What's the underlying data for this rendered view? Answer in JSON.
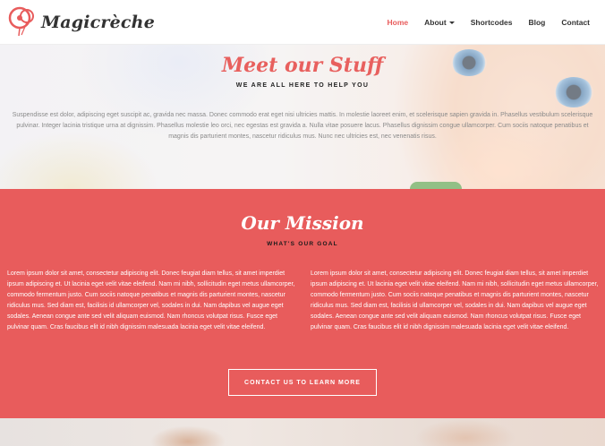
{
  "brand": {
    "name": "Magicrèche",
    "accent": "#e85c5c"
  },
  "nav": {
    "items": [
      {
        "label": "Home",
        "active": true
      },
      {
        "label": "About",
        "dropdown": true
      },
      {
        "label": "Shortcodes"
      },
      {
        "label": "Blog"
      },
      {
        "label": "Contact"
      }
    ]
  },
  "hero": {
    "title": "Meet our Stuff",
    "subtitle": "WE ARE ALL HERE TO HELP YOU",
    "text": "Suspendisse est dolor, adipiscing eget suscipit ac, gravida nec massa. Donec commodo erat eget nisi ultricies mattis. In molestie laoreet enim, et scelerisque sapien gravida in. Phasellus vestibulum scelerisque pulvinar. Integer lacinia tristique urna at dignissim. Phasellus molestie leo orci, nec egestas est gravida a. Nulla vitae posuere lacus. Phasellus dignissim congue ullamcorper. Cum sociis natoque penatibus et magnis dis parturient montes, nascetur ridiculus mus. Nunc nec ultricies est, nec venenatis risus."
  },
  "mission": {
    "title": "Our Mission",
    "subtitle": "WHAT'S OUR GOAL",
    "left_text": "Lorem ipsum dolor sit amet, consectetur adipiscing elit. Donec feugiat diam tellus, sit amet imperdiet ipsum adipiscing et. Ut lacinia eget velit vitae eleifend. Nam mi nibh, sollicitudin eget metus ullamcorper, commodo fermentum justo. Cum sociis natoque penatibus et magnis dis parturient montes, nascetur ridiculus mus. Sed diam est, facilisis id ullamcorper vel, sodales in dui. Nam dapibus vel augue eget sodales. Aenean congue ante sed velit aliquam euismod. Nam rhoncus volutpat risus. Fusce eget pulvinar quam. Cras faucibus elit id nibh dignissim malesuada lacinia eget velit vitae eleifend.",
    "right_text": "Lorem ipsum dolor sit amet, consectetur adipiscing elit. Donec feugiat diam tellus, sit amet imperdiet ipsum adipiscing et. Ut lacinia eget velit vitae eleifend. Nam mi nibh, sollicitudin eget metus ullamcorper, commodo fermentum justo. Cum sociis natoque penatibus et magnis dis parturient montes, nascetur ridiculus mus. Sed diam est, facilisis id ullamcorper vel, sodales in dui. Nam dapibus vel augue eget sodales. Aenean congue ante sed velit aliquam euismod. Nam rhoncus volutpat risus. Fusce eget pulvinar quam. Cras faucibus elit id nibh dignissim malesuada lacinia eget velit vitae eleifend.",
    "cta_label": "CONTACT US TO LEARN MORE"
  }
}
